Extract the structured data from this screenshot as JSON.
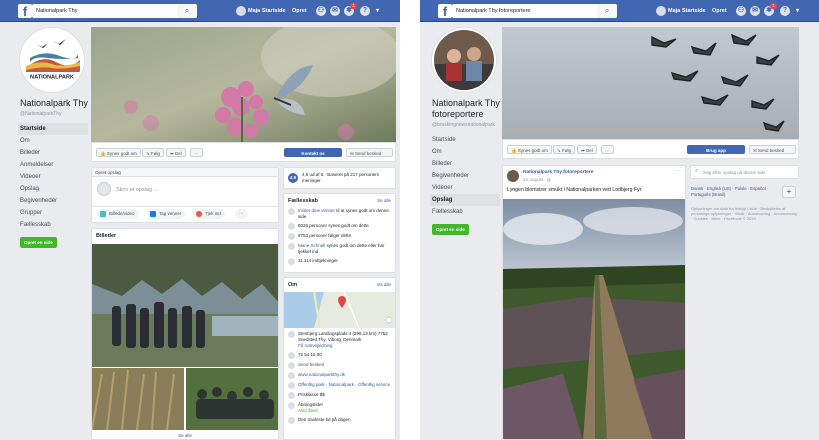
{
  "left": {
    "search_value": "Nationalpark Thy",
    "nav": {
      "user": "Maja",
      "home": "Startside",
      "create": "Opret"
    },
    "badge": "1",
    "page_name": "Nationalpark Thy",
    "handle": "@NationalparkThy",
    "logo_text": "NATIONALPARK",
    "menu": [
      "Startside",
      "Om",
      "Billeder",
      "Anmeldelser",
      "Videoer",
      "Opslag",
      "Begivenheder",
      "Grupper",
      "Fællesskab"
    ],
    "create_page_btn": "Opret en side",
    "actions": {
      "like": "Synes godt om",
      "follow": "Følg",
      "share": "Del",
      "more": "···",
      "contact": "Kontakt os",
      "message": "Send besked"
    },
    "composer": {
      "title": "Opret opslag",
      "placeholder": "Skriv et opslag ...",
      "photo": "Billede/video",
      "tag": "Tag venner",
      "checkin": "Tjek ind",
      "more": "···"
    },
    "photos": {
      "title": "Billeder",
      "see_all": "Se alle"
    },
    "rating": {
      "score": "4.9",
      "text": "4,9 ud af 5 · Baseret på 217 personers meninger"
    },
    "community": {
      "title": "Fællesskab",
      "see_all": "Se alle",
      "invite_link": "Inviter dine venner",
      "invite_rest": " til at synes godt om denne side",
      "likes": "8026 personer synes godt om dette",
      "follows": "8753 personer følger dette",
      "friend_name": "Marie Schnell",
      "friend_rest": " synes godt om dette eller har tjekket ind",
      "checkins": "11.114 indtjekninger"
    },
    "about": {
      "title": "Om",
      "see_all": "Vis alle",
      "address": "Stenbjerg Landingsplads 4 (296,13 km) 7752 Snedsted Thy, Viborg, Denmark",
      "directions": "Få rutevejledning",
      "phone": "72 54 15 00",
      "send_message": "Send besked",
      "website": "www.nationalparkthy.dk",
      "category": "Offentlig park · Nationalpark · Offentlig service",
      "price": "Prisklasse $$",
      "hours": "Åbningstider",
      "open_now": "Altid åben",
      "responsive": "Den travleste tid på dagen"
    }
  },
  "right": {
    "search_value": "Nationalpark Thy fotoreportere",
    "nav": {
      "user": "Maja",
      "home": "Startside",
      "create": "Opret"
    },
    "badge": "1",
    "page_name": "Nationalpark Thy fotoreportere",
    "handle": "@bruskingnewsnationalpark",
    "menu": [
      "Startside",
      "Om",
      "Billeder",
      "Begivenheder",
      "Videoer",
      "Opslag",
      "Fællesskab"
    ],
    "create_page_btn": "Opret en side",
    "actions": {
      "like": "Synes godt om",
      "follow": "Følg",
      "share": "Del",
      "more": "···",
      "use_app": "Brug app",
      "message": "Send besked"
    },
    "post": {
      "author": "Nationalpark Thy fotoreportere",
      "date": "13. august · ",
      "text": "Lyngen blomstrer smukt i Nationalparken ved Lodbjerg Fyr",
      "more": "···"
    },
    "side_search_placeholder": "Søg efter opslag på denne side",
    "languages": "Dansk · English (US) · Polski · Español · Português (Brasil)",
    "footer": "Oplysninger om data fra indsigt i side · Beskyttelse af personlige oplysninger · Vilkår · Annoncering · Annoncevalg · Cookies · Mere · Facebook © 2019"
  }
}
